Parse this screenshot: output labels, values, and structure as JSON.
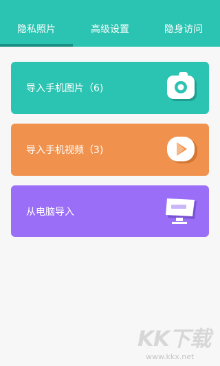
{
  "tabs": [
    {
      "label": "隐私照片"
    },
    {
      "label": "高级设置"
    },
    {
      "label": "隐身访问"
    }
  ],
  "cards": [
    {
      "label": "导入手机图片（6)",
      "color": "#2bc3b1",
      "icon": "camera-icon"
    },
    {
      "label": "导入手机视频（3)",
      "color": "#f0924d",
      "icon": "play-icon"
    },
    {
      "label": "从电脑导入",
      "color": "#9a6ef6",
      "icon": "monitor-icon"
    }
  ],
  "watermark": {
    "brand": "KK下载",
    "url": "www.kkx.net"
  }
}
